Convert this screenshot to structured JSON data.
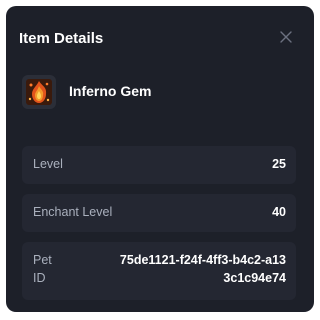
{
  "dialog": {
    "title": "Item Details",
    "close_icon": "close-icon"
  },
  "item": {
    "name": "Inferno Gem",
    "icon": "fire-gem-icon"
  },
  "details": {
    "level": {
      "label": "Level",
      "value": "25"
    },
    "enchant_level": {
      "label": "Enchant Level",
      "value": "40"
    },
    "pet_id": {
      "label": "Pet ID",
      "value": "75de1121-f24f-4ff3-b4c2-a133c1c94e74"
    }
  }
}
